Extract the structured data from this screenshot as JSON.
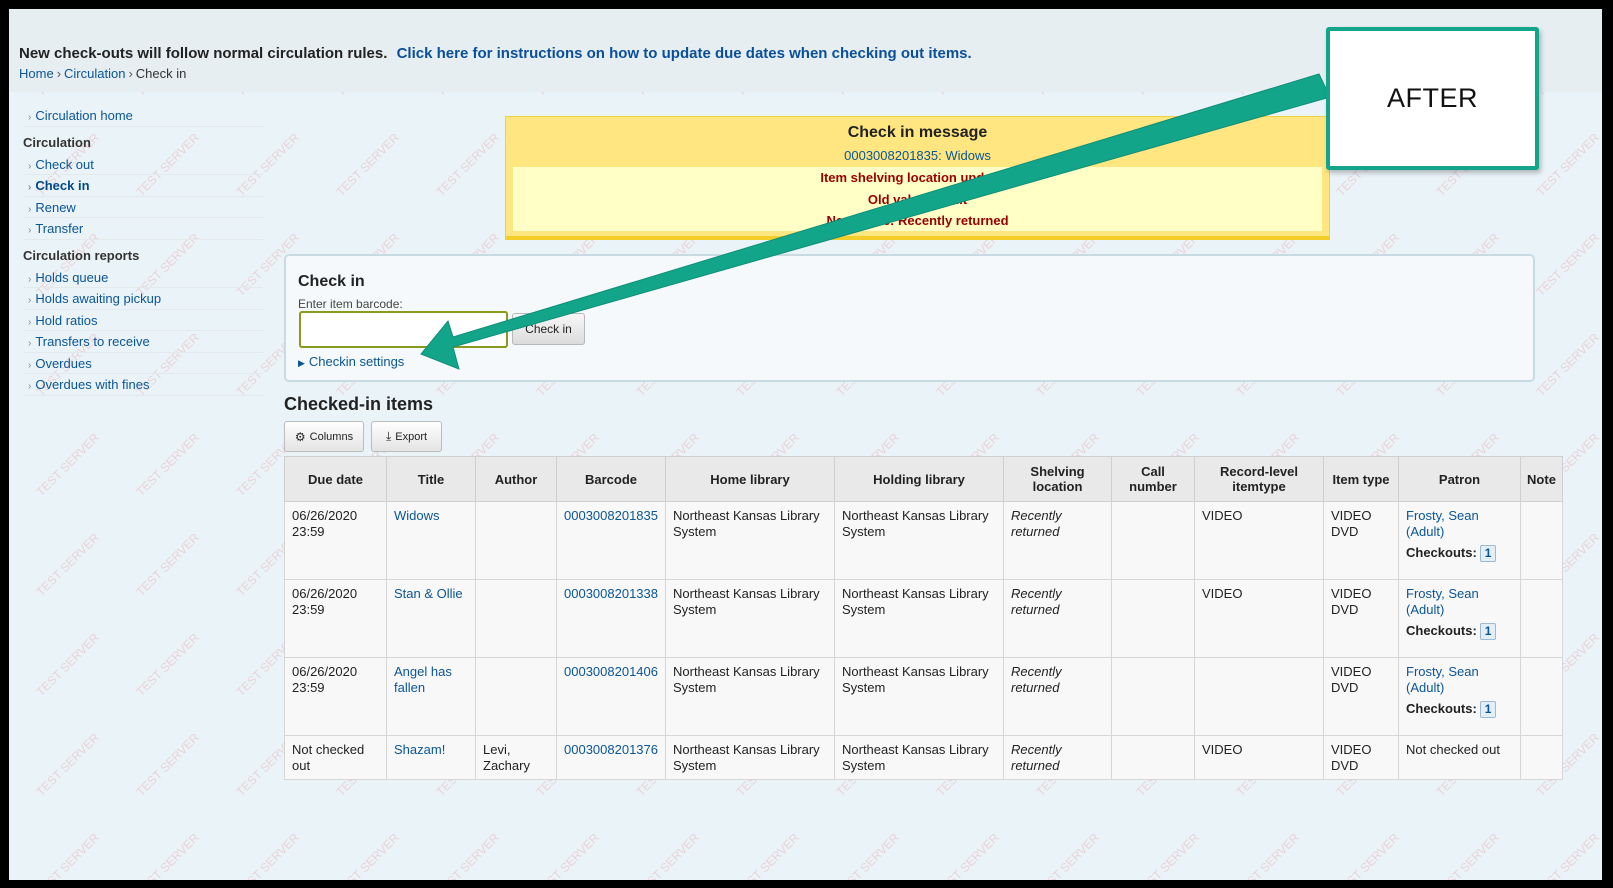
{
  "notice": {
    "text": "New check-outs will follow normal circulation rules.",
    "link": "Click here for instructions on how to update due dates when checking out items."
  },
  "breadcrumb": {
    "home": "Home",
    "sep": "›",
    "circulation": "Circulation",
    "current": "Check in"
  },
  "sidebar": {
    "home": "Circulation home",
    "circ_heading": "Circulation",
    "circ_items": [
      "Check out",
      "Check in",
      "Renew",
      "Transfer"
    ],
    "reports_heading": "Circulation reports",
    "report_items": [
      "Holds queue",
      "Holds awaiting pickup",
      "Hold ratios",
      "Transfers to receive",
      "Overdues",
      "Overdues with fines"
    ]
  },
  "message": {
    "title": "Check in message",
    "item_link": "0003008201835: Widows",
    "line1": "Item shelving location updated.",
    "line2": "Old value: Adult",
    "line3": "New value: Recently returned"
  },
  "checkin": {
    "title": "Check in",
    "label": "Enter item barcode:",
    "input_value": "",
    "button": "Check in",
    "settings": "Checkin settings"
  },
  "checked_in": {
    "title": "Checked-in items",
    "columns_btn": "Columns",
    "export_btn": "Export",
    "headers": [
      "Due date",
      "Title",
      "Author",
      "Barcode",
      "Home library",
      "Holding library",
      "Shelving location",
      "Call number",
      "Record-level itemtype",
      "Item type",
      "Patron",
      "Note"
    ],
    "rows": [
      {
        "due": "06/26/2020 23:59",
        "title": "Widows",
        "author": "",
        "barcode": "0003008201835",
        "home": "Northeast Kansas Library System",
        "holding": "Northeast Kansas Library System",
        "shelving": "Recently returned",
        "call": "",
        "record_itemtype": "VIDEO",
        "itemtype": "VIDEO DVD",
        "patron": "Frosty, Sean (Adult)",
        "checkouts_label": "Checkouts:",
        "checkouts": "1",
        "note": ""
      },
      {
        "due": "06/26/2020 23:59",
        "title": "Stan & Ollie",
        "author": "",
        "barcode": "0003008201338",
        "home": "Northeast Kansas Library System",
        "holding": "Northeast Kansas Library System",
        "shelving": "Recently returned",
        "call": "",
        "record_itemtype": "VIDEO",
        "itemtype": "VIDEO DVD",
        "patron": "Frosty, Sean (Adult)",
        "checkouts_label": "Checkouts:",
        "checkouts": "1",
        "note": ""
      },
      {
        "due": "06/26/2020 23:59",
        "title": "Angel has fallen",
        "author": "",
        "barcode": "0003008201406",
        "home": "Northeast Kansas Library System",
        "holding": "Northeast Kansas Library System",
        "shelving": "Recently returned",
        "call": "",
        "record_itemtype": "",
        "itemtype": "VIDEO DVD",
        "patron": "Frosty, Sean (Adult)",
        "checkouts_label": "Checkouts:",
        "checkouts": "1",
        "note": ""
      },
      {
        "due": "Not checked out",
        "title": "Shazam!",
        "author": "Levi, Zachary",
        "barcode": "0003008201376",
        "home": "Northeast Kansas Library System",
        "holding": "Northeast Kansas Library System",
        "shelving": "Recently returned",
        "call": "",
        "record_itemtype": "VIDEO",
        "itemtype": "VIDEO DVD",
        "patron_plain": "Not checked out",
        "note": ""
      }
    ]
  },
  "annotation": {
    "label": "AFTER",
    "color": "#13a58a"
  },
  "colors": {
    "link": "#0a5596",
    "message_bg": "#ffe680",
    "message_text": "#990000",
    "page_bg": "#eaf3f8"
  },
  "icons": {
    "columns": "gear-icon",
    "export": "download-icon",
    "settings": "triangle-right-icon",
    "sidebar": "chevron-right-icon"
  }
}
